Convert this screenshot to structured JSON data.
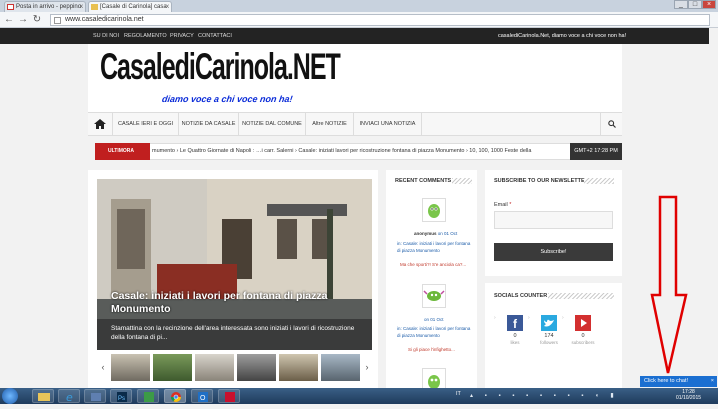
{
  "browser": {
    "tabs": [
      {
        "label": "Posta in arrivo - peppino",
        "close": "x"
      },
      {
        "label": "[Casale di Carinola] casa",
        "close": "x"
      }
    ],
    "url": "www.casaledicarinola.net"
  },
  "topbar": {
    "links": [
      "SU DI NOI",
      "REGOLAMENTO",
      "PRIVACY",
      "CONTATTACI"
    ],
    "tagline": "casalediCarinola.Net, diamo voce a chi voce non ha!"
  },
  "logo": {
    "title": "CasalediCarinola.NET",
    "subtitle": "diamo voce a chi voce non ha!"
  },
  "nav": {
    "items": [
      "CASALE IERI E OGGI",
      "NOTIZIE DA CASALE",
      "NOTIZIE DAL COMUNE",
      "Altre NOTIZIE",
      "INVIACI UNA NOTIZIA"
    ]
  },
  "ticker": {
    "label": "ULTIMORA",
    "text": "mumento  ›  Le Quattro Giornate di Napoli : …i carr. Salerni  ›  Casale: iniziati lavori per ricostruzione fontana di piazza Monumento  ›  10, 100, 1000 Feste della",
    "time": "GMT+2 17:28 PM"
  },
  "feature": {
    "title": "Casale: iniziati i lavori per fontana di piazza Monumento",
    "excerpt": "Stamattina con la recinzione dell'area interessata sono iniziati i lavori di ricostruzione della fontana di pi...",
    "prev": "‹",
    "next": "›"
  },
  "recent_comments": {
    "title": "RECENT COMMENTS",
    "items": [
      {
        "author": "anonymus",
        "date": "on 01 Oct",
        "prefix": "in:",
        "link": "Casale: iniziati i lavori per fontana di piazza Monumento",
        "excerpt": "Ma che sporti?! S'e anciola ca?..."
      },
      {
        "author": "",
        "date": "on 01 Oct",
        "prefix": "in:",
        "link": "Casale: iniziati i lavori per fontana di piazza Monumento",
        "excerpt": "Si gli piace l'infighetto..."
      }
    ]
  },
  "newsletter": {
    "title": "SUBSCRIBE TO OUR NEWSLETTER",
    "email_label": "Email",
    "required": "*",
    "button": "Subscribe!"
  },
  "socials": {
    "title": "SOCIALS COUNTER",
    "items": [
      {
        "icon": "facebook-icon",
        "count": "0",
        "label": "likes"
      },
      {
        "icon": "twitter-icon",
        "count": "174",
        "label": "followers"
      },
      {
        "icon": "youtube-icon",
        "count": "0",
        "label": "subscribers"
      }
    ]
  },
  "chat": {
    "label": "Click here to chat!"
  },
  "taskbar": {
    "lang": "IT",
    "time": "17:28",
    "date": "01/10/2015"
  },
  "colors": {
    "accent": "#c01f1f",
    "topbar": "#232323",
    "chat": "#1b6fd1",
    "arrow": "#e00000"
  }
}
